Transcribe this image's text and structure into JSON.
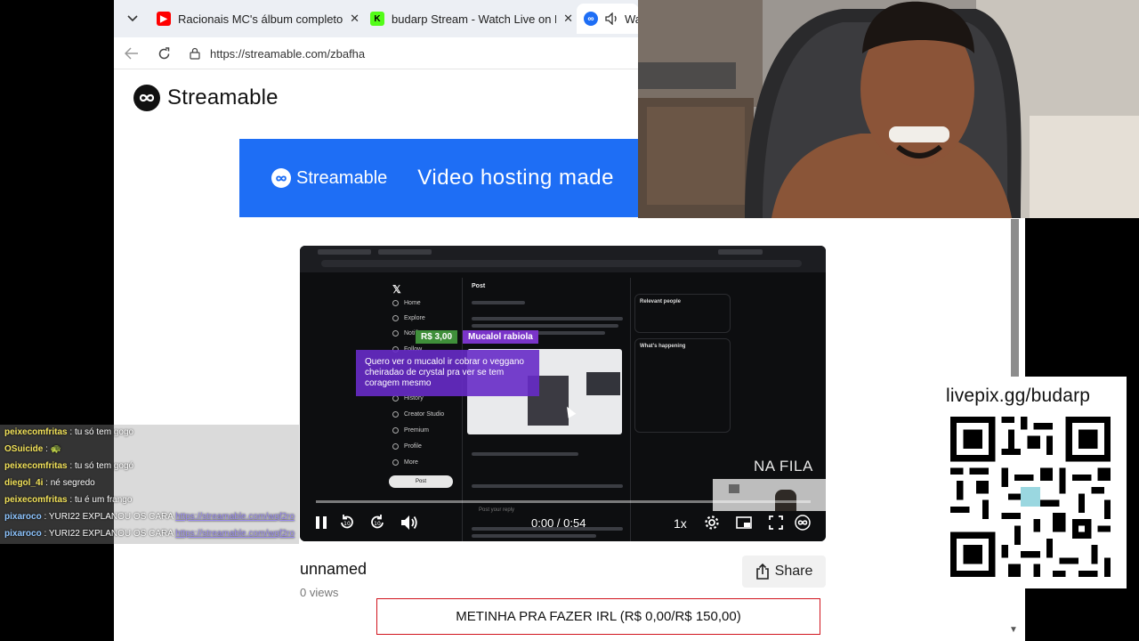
{
  "browser": {
    "tabs": [
      {
        "title": "Racionais MC's álbum completo -",
        "icon": "youtube-icon",
        "color": "#ff0000"
      },
      {
        "title": "budarp Stream - Watch Live on Kic",
        "icon": "kick-icon",
        "color": "#53fc18"
      },
      {
        "title": "Wa",
        "icon": "streamable-icon",
        "color": "#1e6ef5"
      }
    ],
    "url": "https://streamable.com/zbafha"
  },
  "page": {
    "logo_text": "Streamable",
    "banner": {
      "brand": "Streamable",
      "tagline": "Video hosting made"
    },
    "video": {
      "title": "unnamed",
      "views": "0 views",
      "time": "0:00 / 0:54",
      "speed": "1x",
      "progress": 0.0,
      "share_label": "Share"
    }
  },
  "video_frame": {
    "donation_amount": "R$ 3,00",
    "donation_user": "Mucalol rabiola",
    "donation_message": "Quero ver o mucalol ir cobrar o veggano cheiradao de crystal pra ver se tem coragem mesmo",
    "queue_label": "NA FILA",
    "x_post_header": "Post",
    "x_relevant": "Relevant people",
    "x_happening": "What's happening",
    "x_nav": [
      "Home",
      "Explore",
      "Notifi",
      "Follow",
      "History",
      "Creator Studio",
      "Premium",
      "Profile",
      "More"
    ],
    "x_post_button": "Post",
    "x_reply_placeholder": "Post your reply"
  },
  "goal": {
    "text": "METINHA PRA FAZER IRL (R$ 0,00/R$ 150,00)"
  },
  "chat": [
    {
      "user": "peixecomfritas",
      "color": "#f2e25a",
      "message": "tu só tem gogo",
      "link": ""
    },
    {
      "user": "OSuicide",
      "color": "#f2e25a",
      "message": "",
      "link": "",
      "emote": "🐢"
    },
    {
      "user": "peixecomfritas",
      "color": "#f2e25a",
      "message": "tu só tem gogó",
      "link": ""
    },
    {
      "user": "diegol_4i",
      "color": "#f2e25a",
      "message": "né segredo",
      "link": ""
    },
    {
      "user": "peixecomfritas",
      "color": "#f2e25a",
      "message": "tu é um frango",
      "link": ""
    },
    {
      "user": "pixaroco",
      "color": "#8ec5ff",
      "message": "YURI22 EXPLANOU OS CARA",
      "link": "https://streamable.com/wqf2ro"
    },
    {
      "user": "pixaroco",
      "color": "#8ec5ff",
      "message": "YURI22 EXPLANOU OS CARA",
      "link": "https://streamable.com/wqf2ro"
    }
  ],
  "qr": {
    "url": "livepix.gg/budarp"
  }
}
